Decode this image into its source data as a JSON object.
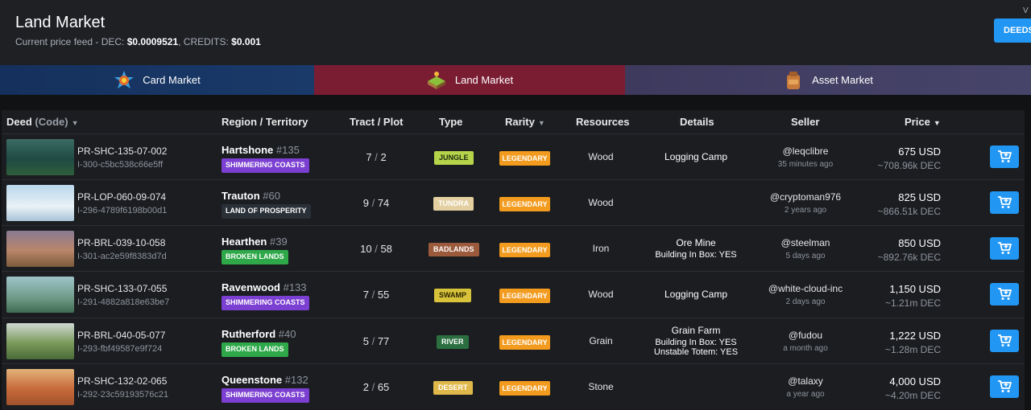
{
  "header": {
    "title": "Land Market",
    "price_feed_label": "Current price feed - DEC: ",
    "dec_price": "$0.0009521",
    "credits_label": ", CREDITS: ",
    "credits_price": "$0.001",
    "corner_text": "V",
    "deeds_button": "DEEDS"
  },
  "tabs": [
    {
      "label": "Card Market",
      "icon": "card-market-icon"
    },
    {
      "label": "Land Market",
      "icon": "land-market-icon"
    },
    {
      "label": "Asset Market",
      "icon": "asset-market-icon"
    }
  ],
  "columns": {
    "deed": "Deed",
    "deed_code": "(Code)",
    "region": "Region / Territory",
    "tract": "Tract",
    "plot": "Plot",
    "type": "Type",
    "rarity": "Rarity",
    "resources": "Resources",
    "details": "Details",
    "seller": "Seller",
    "price": "Price"
  },
  "rows": [
    {
      "code": "PR-SHC-135-07-002",
      "id": "I-300-c5bc538c66e5ff",
      "region": "Hartshone",
      "region_num": "#135",
      "territory": "SHIMMERING COASTS",
      "tract": "7",
      "plot": "2",
      "type": "JUNGLE",
      "rarity": "LEGENDARY",
      "resource": "Wood",
      "detail": "Logging Camp",
      "detail_sub": "",
      "detail_sub2": "",
      "seller": "@leqclibre",
      "seller_time": "35 minutes ago",
      "price": "675 USD",
      "price_dec": "~708.96k DEC"
    },
    {
      "code": "PR-LOP-060-09-074",
      "id": "I-296-4789f6198b00d1",
      "region": "Trauton",
      "region_num": "#60",
      "territory": "LAND OF PROSPERITY",
      "tract": "9",
      "plot": "74",
      "type": "TUNDRA",
      "rarity": "LEGENDARY",
      "resource": "Wood",
      "detail": "",
      "detail_sub": "",
      "detail_sub2": "",
      "seller": "@cryptoman976",
      "seller_time": "2 years ago",
      "price": "825 USD",
      "price_dec": "~866.51k DEC"
    },
    {
      "code": "PR-BRL-039-10-058",
      "id": "I-301-ac2e59f8383d7d",
      "region": "Hearthen",
      "region_num": "#39",
      "territory": "BROKEN LANDS",
      "tract": "10",
      "plot": "58",
      "type": "BADLANDS",
      "rarity": "LEGENDARY",
      "resource": "Iron",
      "detail": "Ore Mine",
      "detail_sub": "Building In Box: YES",
      "detail_sub2": "",
      "seller": "@steelman",
      "seller_time": "5 days ago",
      "price": "850 USD",
      "price_dec": "~892.76k DEC"
    },
    {
      "code": "PR-SHC-133-07-055",
      "id": "I-291-4882a818e63be7",
      "region": "Ravenwood",
      "region_num": "#133",
      "territory": "SHIMMERING COASTS",
      "tract": "7",
      "plot": "55",
      "type": "SWAMP",
      "rarity": "LEGENDARY",
      "resource": "Wood",
      "detail": "Logging Camp",
      "detail_sub": "",
      "detail_sub2": "",
      "seller": "@white-cloud-inc",
      "seller_time": "2 days ago",
      "price": "1,150 USD",
      "price_dec": "~1.21m DEC"
    },
    {
      "code": "PR-BRL-040-05-077",
      "id": "I-293-fbf49587e9f724",
      "region": "Rutherford",
      "region_num": "#40",
      "territory": "BROKEN LANDS",
      "tract": "5",
      "plot": "77",
      "type": "RIVER",
      "rarity": "LEGENDARY",
      "resource": "Grain",
      "detail": "Grain Farm",
      "detail_sub": "Building In Box: YES",
      "detail_sub2": "Unstable Totem: YES",
      "seller": "@fudou",
      "seller_time": "a month ago",
      "price": "1,222 USD",
      "price_dec": "~1.28m DEC"
    },
    {
      "code": "PR-SHC-132-02-065",
      "id": "I-292-23c59193576c21",
      "region": "Queenstone",
      "region_num": "#132",
      "territory": "SHIMMERING COASTS",
      "tract": "2",
      "plot": "65",
      "type": "DESERT",
      "rarity": "LEGENDARY",
      "resource": "Stone",
      "detail": "",
      "detail_sub": "",
      "detail_sub2": "",
      "seller": "@talaxy",
      "seller_time": "a year ago",
      "price": "4,000 USD",
      "price_dec": "~4.20m DEC"
    }
  ],
  "colors": {
    "accent_blue": "#2196f3",
    "legendary": "#f29b1e",
    "shimmering_coasts": "#7b3fd1",
    "land_of_prosperity": "#2a3038",
    "broken_lands": "#2fa84a",
    "jungle": "#b6d44a",
    "tundra": "#e3cfa0",
    "badlands": "#9b5a3c",
    "swamp": "#d8c23a",
    "river": "#2b6e3f",
    "desert": "#e0b84a"
  }
}
